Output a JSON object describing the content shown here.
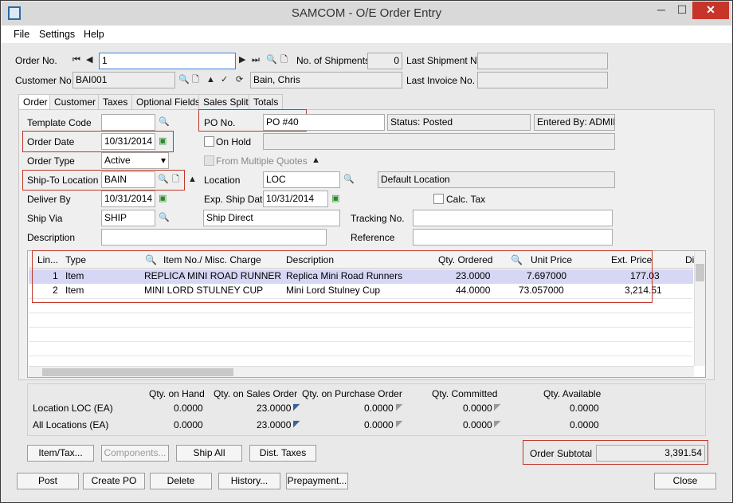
{
  "window": {
    "title": "SAMCOM - O/E Order Entry",
    "minimize": "─",
    "maximize": "☐",
    "close": "✕"
  },
  "menu": [
    "File",
    "Settings",
    "Help"
  ],
  "header": {
    "order_no_label": "Order No.",
    "order_no": "1",
    "num_shipments_label": "No. of Shipments",
    "num_shipments": "0",
    "last_shipment_label": "Last Shipment No.",
    "last_shipment": "",
    "customer_no_label": "Customer No.",
    "customer_no": "BAI001",
    "customer_name": "Bain, Chris",
    "last_invoice_label": "Last Invoice No.",
    "last_invoice": ""
  },
  "tabs": [
    "Order",
    "Customer",
    "Taxes",
    "Optional Fields",
    "Sales Split",
    "Totals"
  ],
  "form": {
    "template_code_label": "Template Code",
    "template_code": "",
    "po_no_label": "PO No.",
    "po_no": "PO #40",
    "status": "Status: Posted",
    "entered_by": "Entered By: ADMIN",
    "order_date_label": "Order Date",
    "order_date": "10/31/2014",
    "on_hold_label": "On Hold",
    "order_type_label": "Order Type",
    "order_type": "Active",
    "from_quotes_label": "From Multiple Quotes",
    "ship_to_label": "Ship-To Location",
    "ship_to": "BAIN",
    "location_label": "Location",
    "location": "LOC",
    "location_desc": "Default Location",
    "deliver_by_label": "Deliver By",
    "deliver_by": "10/31/2014",
    "exp_ship_label": "Exp. Ship Date",
    "exp_ship": "10/31/2014",
    "calc_tax_label": "Calc. Tax",
    "ship_via_label": "Ship Via",
    "ship_via": "SHIP",
    "ship_via_desc": "Ship Direct",
    "tracking_label": "Tracking No.",
    "tracking": "",
    "description_label": "Description",
    "description": "",
    "reference_label": "Reference",
    "reference": ""
  },
  "grid": {
    "columns": [
      "Lin...",
      "Type",
      "Item No./ Misc. Charge",
      "Description",
      "Qty. Ordered",
      "Unit Price",
      "Ext. Price",
      "Dis"
    ],
    "rows": [
      {
        "line": "1",
        "type": "Item",
        "item": "REPLICA MINI ROAD RUNNER",
        "desc": "Replica Mini Road Runners",
        "qty": "23.0000",
        "price": "7.697000",
        "ext": "177.03"
      },
      {
        "line": "2",
        "type": "Item",
        "item": "MINI LORD STULNEY CUP",
        "desc": "Mini Lord Stulney Cup",
        "qty": "44.0000",
        "price": "73.057000",
        "ext": "3,214.51"
      }
    ]
  },
  "qty": {
    "headers": [
      "Qty. on Hand",
      "Qty. on Sales Order",
      "Qty. on Purchase Order",
      "Qty. Committed",
      "Qty. Available"
    ],
    "rows": [
      {
        "label": "Location  LOC (EA)",
        "vals": [
          "0.0000",
          "23.0000",
          "0.0000",
          "0.0000",
          "0.0000"
        ]
      },
      {
        "label": "All Locations (EA)",
        "vals": [
          "0.0000",
          "23.0000",
          "0.0000",
          "0.0000",
          "0.0000"
        ]
      }
    ]
  },
  "buttons": {
    "item_tax": "Item/Tax...",
    "components": "Components...",
    "ship_all": "Ship All",
    "dist_taxes": "Dist. Taxes",
    "post": "Post",
    "create_po": "Create PO",
    "delete": "Delete",
    "history": "History...",
    "prepayment": "Prepayment...",
    "close": "Close"
  },
  "subtotal": {
    "label": "Order Subtotal",
    "value": "3,391.54"
  }
}
